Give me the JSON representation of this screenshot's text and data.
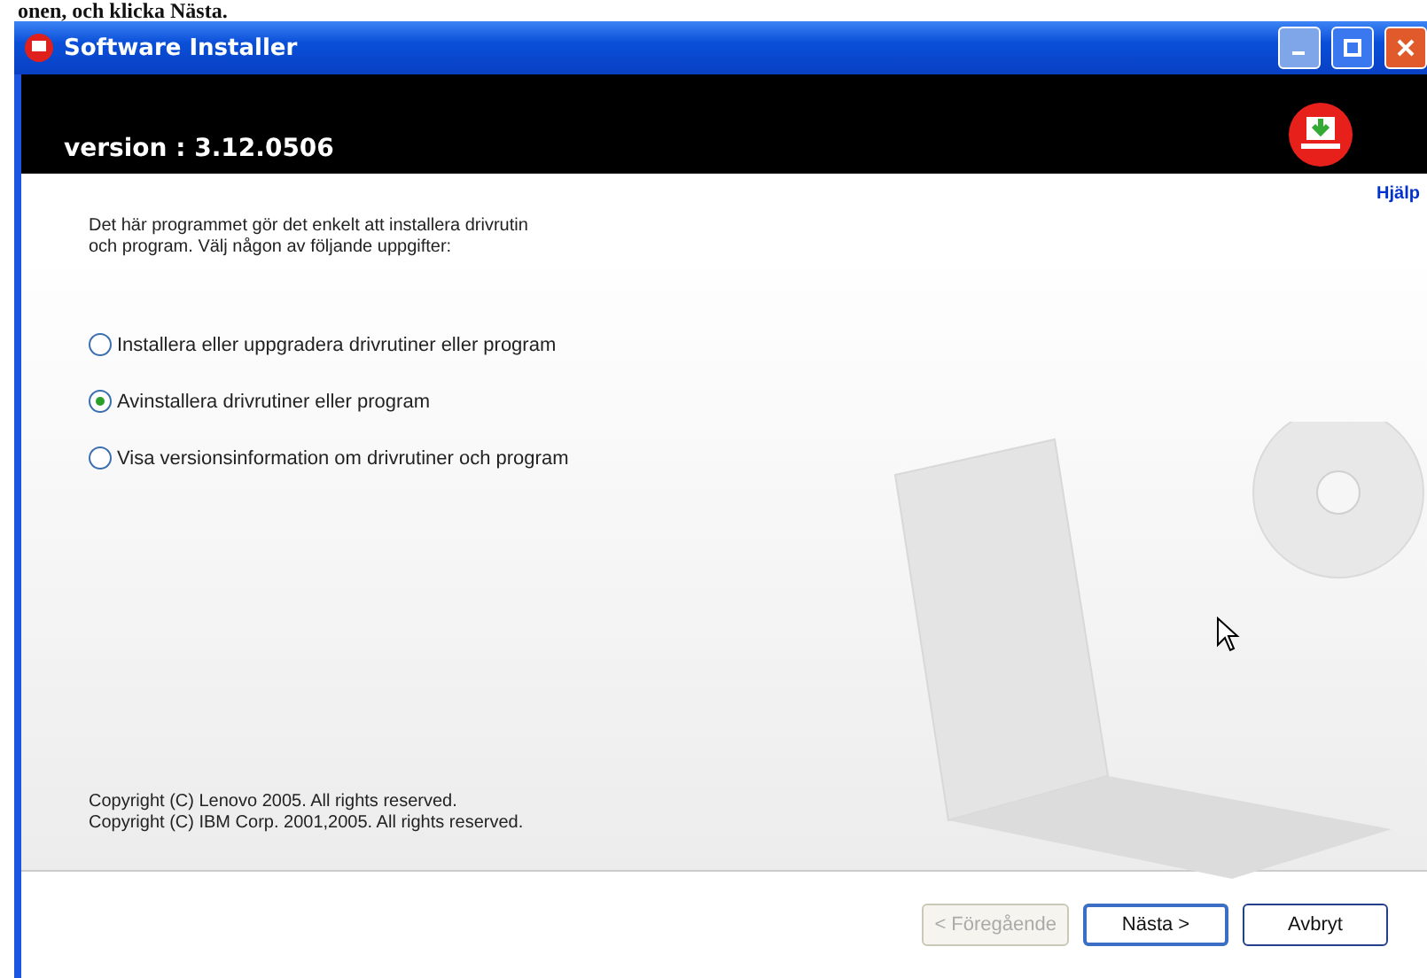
{
  "caption": "onen, och klicka Nästa.",
  "window": {
    "title": "Software Installer"
  },
  "header": {
    "version": "version : 3.12.0506"
  },
  "help_link": "Hjälp",
  "intro": "Det här programmet gör det enkelt att installera drivrutin\noch program. Välj någon av följande uppgifter:",
  "options": [
    {
      "label": "Installera eller uppgradera drivrutiner eller program",
      "selected": false
    },
    {
      "label": "Avinstallera drivrutiner eller program",
      "selected": true
    },
    {
      "label": "Visa versionsinformation om drivrutiner och program",
      "selected": false
    }
  ],
  "copyright": [
    "Copyright (C) Lenovo 2005. All rights reserved.",
    "Copyright (C) IBM Corp. 2001,2005. All rights reserved."
  ],
  "buttons": [
    {
      "label": "< Föregående",
      "disabled": true,
      "focused": false
    },
    {
      "label": "Nästa >",
      "disabled": false,
      "focused": true
    },
    {
      "label": "Avbryt",
      "disabled": false,
      "focused": false
    }
  ]
}
